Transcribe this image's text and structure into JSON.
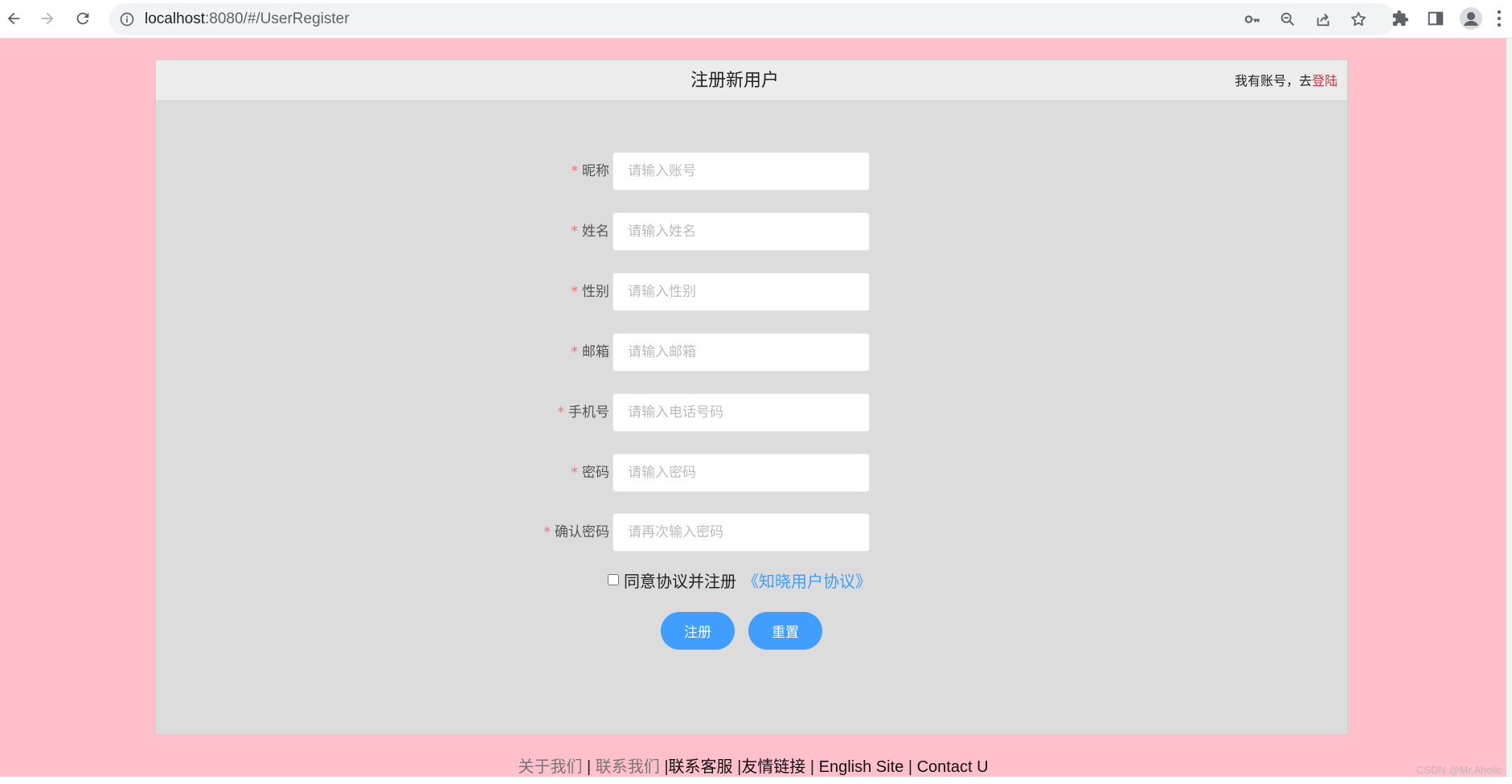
{
  "browser": {
    "url_host": "localhost",
    "url_rest": ":8080/#/UserRegister"
  },
  "page": {
    "title": "注册新用户",
    "login_hint": "我有账号，去",
    "login_link": "登陆",
    "fields": [
      {
        "label": "昵称",
        "placeholder": "请输入账号"
      },
      {
        "label": "姓名",
        "placeholder": "请输入姓名"
      },
      {
        "label": "性别",
        "placeholder": "请输入性别"
      },
      {
        "label": "邮箱",
        "placeholder": "请输入邮箱"
      },
      {
        "label": "手机号",
        "placeholder": "请输入电话号码"
      },
      {
        "label": "密码",
        "placeholder": "请输入密码"
      },
      {
        "label": "确认密码",
        "placeholder": "请再次输入密码"
      }
    ],
    "required_mark": "*",
    "agree_text": "同意协议并注册",
    "agree_link": "《知晓用户协议》",
    "register_button": "注册",
    "reset_button": "重置"
  },
  "footer": {
    "about": "关于我们",
    "contact": "联系我们",
    "service": "联系客服",
    "links": "友情链接",
    "english": "English Site",
    "contact_u": "Contact U",
    "separator": "|"
  },
  "watermark": "CSDN @Mr.Aholic",
  "colors": {
    "page_bg": "#ffc0cb",
    "card_bg": "#dcdcdc",
    "header_bg": "#ececec",
    "primary": "#409eff",
    "login_link": "#e52b3b",
    "required": "#f56c6c"
  }
}
